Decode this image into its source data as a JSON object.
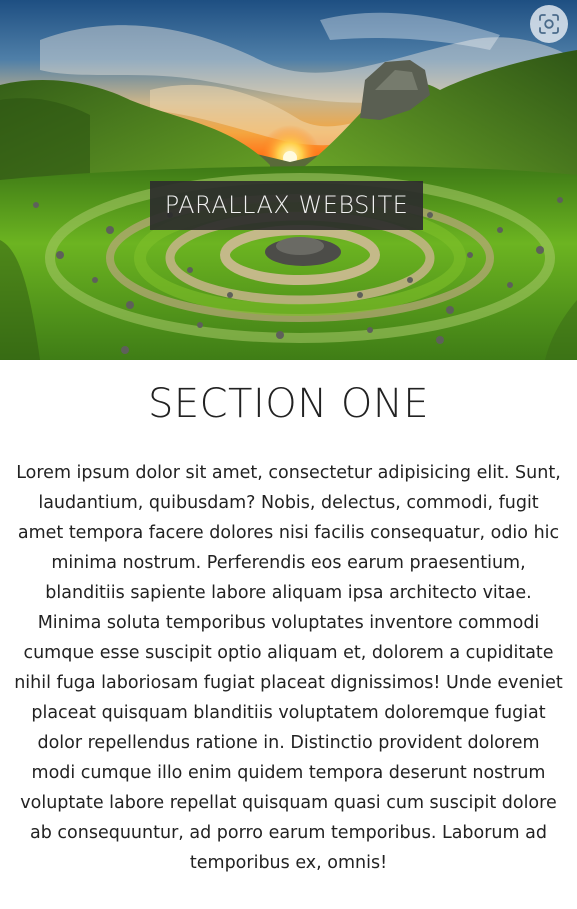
{
  "hero": {
    "caption": "PARALLAX WEBSITE",
    "background_image": "green spiral stone circle landscape at sunset",
    "lens_icon": "screenshot-lens-icon"
  },
  "section_one": {
    "title": "SECTION ONE",
    "body": "Lorem ipsum dolor sit amet, consectetur adipisicing elit. Sunt, laudantium, quibusdam? Nobis, delectus, commodi, fugit amet tempora facere dolores nisi facilis consequatur, odio hic minima nostrum. Perferendis eos earum praesentium, blanditiis sapiente labore aliquam ipsa architecto vitae. Minima soluta temporibus voluptates inventore commodi cumque esse suscipit optio aliquam et, dolorem a cupiditate nihil fuga laboriosam fugiat placeat dignissimos! Unde eveniet placeat quisquam blanditiis voluptatem doloremque fugiat dolor repellendus ratione in. Distinctio provident dolorem modi cumque illo enim quidem tempora deserunt nostrum voluptate labore repellat quisquam quasi cum suscipit dolore ab consequuntur, ad porro earum temporibus. Laborum ad temporibus ex, omnis!"
  },
  "colors": {
    "caption_bg": "#2c2c2c",
    "text": "#222222",
    "grass": "#5fa424",
    "sky": "#3b6f9e"
  }
}
